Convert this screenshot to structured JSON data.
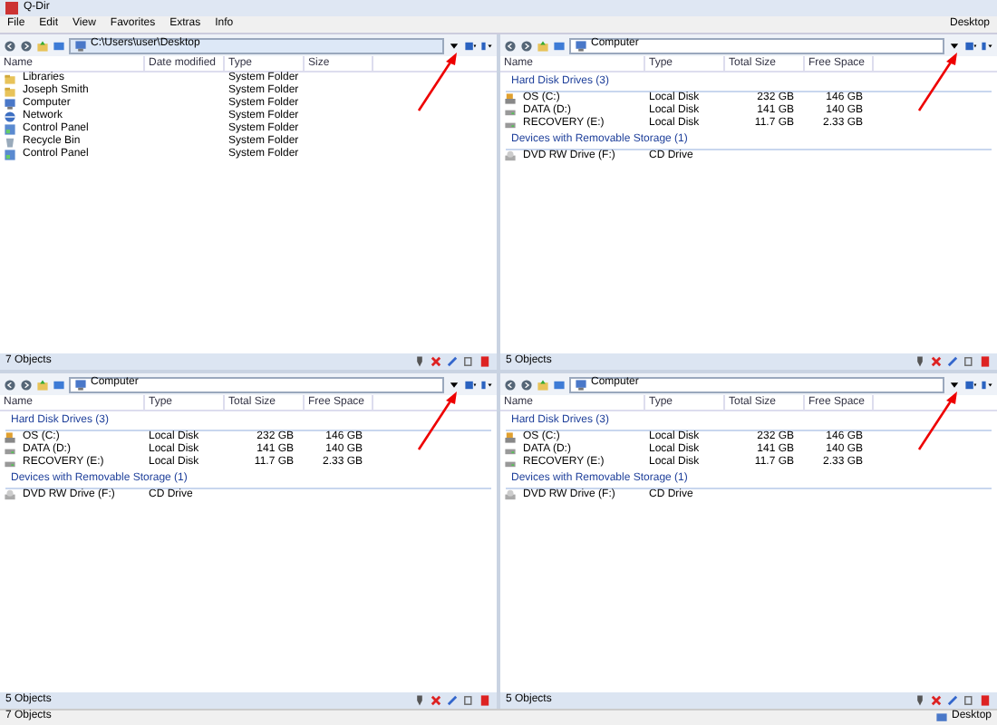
{
  "window": {
    "title": "Q-Dir"
  },
  "menu": [
    "File",
    "Edit",
    "View",
    "Favorites",
    "Extras",
    "Info"
  ],
  "quick_link": "Desktop",
  "panes": [
    {
      "address": "C:\\Users\\user\\Desktop",
      "columns": [
        "Name",
        "Date modified",
        "Type",
        "Size"
      ],
      "groups": [
        {
          "rows": [
            {
              "kind": "folder",
              "cells": [
                "Libraries",
                null,
                "System Folder",
                null
              ]
            },
            {
              "kind": "folder",
              "cells": [
                "Joseph Smith",
                null,
                "System Folder",
                null
              ]
            },
            {
              "kind": "computer",
              "cells": [
                "Computer",
                null,
                "System Folder",
                null
              ]
            },
            {
              "kind": "network",
              "cells": [
                "Network",
                null,
                "System Folder",
                null
              ]
            },
            {
              "kind": "panel",
              "cells": [
                "Control Panel",
                null,
                "System Folder",
                null
              ]
            },
            {
              "kind": "bin",
              "cells": [
                "Recycle Bin",
                null,
                "System Folder",
                null
              ]
            },
            {
              "kind": "panel",
              "cells": [
                "Control Panel",
                null,
                "System Folder",
                null
              ]
            }
          ]
        }
      ],
      "footer": "7 Objects",
      "active": true
    },
    {
      "address": "Computer",
      "columns": [
        "Name",
        "Type",
        "Total Size",
        "Free Space"
      ],
      "groups": [
        {
          "title": "Hard Disk Drives (3)",
          "rows": [
            {
              "kind": "system-drive",
              "cells": [
                "OS (C:)",
                "Local Disk",
                "232 GB",
                "146 GB"
              ]
            },
            {
              "kind": "drive",
              "cells": [
                "DATA (D:)",
                "Local Disk",
                "141 GB",
                "140 GB"
              ]
            },
            {
              "kind": "drive",
              "cells": [
                "RECOVERY (E:)",
                "Local Disk",
                "11.7 GB",
                "2.33 GB"
              ]
            }
          ]
        },
        {
          "title": "Devices with Removable Storage (1)",
          "rows": [
            {
              "kind": "optical",
              "cells": [
                "DVD RW Drive (F:)",
                "CD Drive",
                null,
                null
              ]
            }
          ]
        }
      ],
      "footer": "5 Objects",
      "active": false
    },
    {
      "address": "Computer",
      "columns": [
        "Name",
        "Type",
        "Total Size",
        "Free Space"
      ],
      "groups": [
        {
          "title": "Hard Disk Drives (3)",
          "rows": [
            {
              "kind": "system-drive",
              "cells": [
                "OS (C:)",
                "Local Disk",
                "232 GB",
                "146 GB"
              ]
            },
            {
              "kind": "drive",
              "cells": [
                "DATA (D:)",
                "Local Disk",
                "141 GB",
                "140 GB"
              ]
            },
            {
              "kind": "drive",
              "cells": [
                "RECOVERY (E:)",
                "Local Disk",
                "11.7 GB",
                "2.33 GB"
              ]
            }
          ]
        },
        {
          "title": "Devices with Removable Storage (1)",
          "rows": [
            {
              "kind": "optical",
              "cells": [
                "DVD RW Drive (F:)",
                "CD Drive",
                null,
                null
              ]
            }
          ]
        }
      ],
      "footer": "5 Objects",
      "active": false
    },
    {
      "address": "Computer",
      "columns": [
        "Name",
        "Type",
        "Total Size",
        "Free Space"
      ],
      "groups": [
        {
          "title": "Hard Disk Drives (3)",
          "rows": [
            {
              "kind": "system-drive",
              "cells": [
                "OS (C:)",
                "Local Disk",
                "232 GB",
                "146 GB"
              ]
            },
            {
              "kind": "drive",
              "cells": [
                "DATA (D:)",
                "Local Disk",
                "141 GB",
                "140 GB"
              ]
            },
            {
              "kind": "drive",
              "cells": [
                "RECOVERY (E:)",
                "Local Disk",
                "11.7 GB",
                "2.33 GB"
              ]
            }
          ]
        },
        {
          "title": "Devices with Removable Storage (1)",
          "rows": [
            {
              "kind": "optical",
              "cells": [
                "DVD RW Drive (F:)",
                "CD Drive",
                null,
                null
              ]
            }
          ]
        }
      ],
      "footer": "5 Objects",
      "active": false
    }
  ],
  "status_bar": {
    "objects": "7 Objects",
    "location": "Desktop"
  }
}
